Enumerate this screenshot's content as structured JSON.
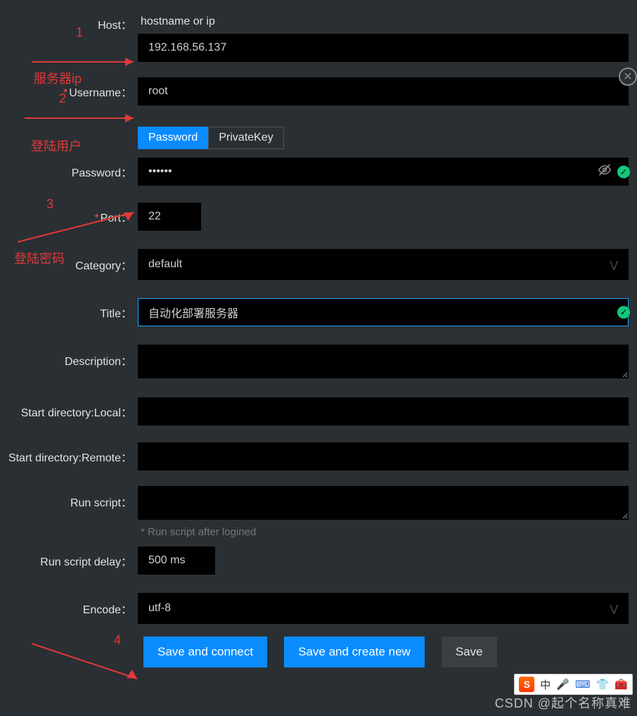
{
  "labels": {
    "host": "Host：",
    "host_placeholder": "hostname or ip",
    "username": "Username：",
    "password": "Password：",
    "port": "Port：",
    "category": "Category：",
    "title": "Title：",
    "description": "Description：",
    "start_local": "Start directory:Local：",
    "start_remote": "Start directory:Remote：",
    "run_script": "Run script：",
    "run_script_hint": "* Run script after logined",
    "run_script_delay": "Run script delay：",
    "encode": "Encode："
  },
  "values": {
    "host": "192.168.56.137",
    "username": "root",
    "password": "••••••",
    "port": "22",
    "category": "default",
    "title": "自动化部署服务器",
    "description": "",
    "start_local": "",
    "start_remote": "",
    "run_script": "",
    "run_script_delay": "500 ms",
    "encode": "utf-8"
  },
  "tabs": {
    "password": "Password",
    "private_key": "PrivateKey"
  },
  "buttons": {
    "save_connect": "Save and connect",
    "save_create": "Save and create new",
    "save": "Save"
  },
  "annotations": {
    "n1": "1",
    "a1": "服务器ip",
    "n2": "2",
    "a2": "登陆用户",
    "n3": "3",
    "a3": "登陆密码",
    "n4": "4"
  },
  "ime": {
    "zhong": "中"
  },
  "watermark": "CSDN @起个名称真难"
}
